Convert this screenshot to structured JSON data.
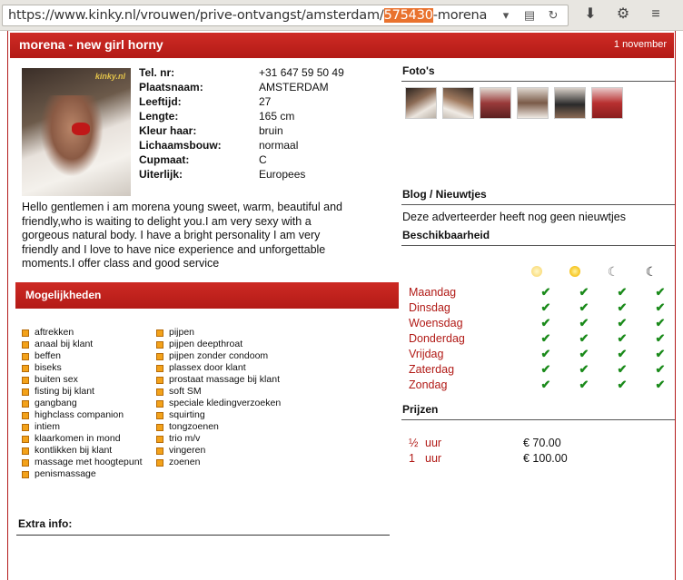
{
  "browser": {
    "url_prefix": "https://www.kinky.nl/vrouwen/prive-ontvangst/amsterdam/",
    "url_highlight": "575430",
    "url_suffix": "-morena"
  },
  "header": {
    "title": "morena - new girl horny",
    "date": "1 november"
  },
  "photo": {
    "watermark": "kinky.nl"
  },
  "details": [
    {
      "label": "Tel. nr:",
      "value": "+31 647 59 50 49"
    },
    {
      "label": "Plaatsnaam:",
      "value": "AMSTERDAM"
    },
    {
      "label": "Leeftijd:",
      "value": "27"
    },
    {
      "label": "Lengte:",
      "value": "165 cm"
    },
    {
      "label": "Kleur haar:",
      "value": "bruin"
    },
    {
      "label": "Lichaamsbouw:",
      "value": "normaal"
    },
    {
      "label": "Cupmaat:",
      "value": "C"
    },
    {
      "label": "Uiterlijk:",
      "value": "Europees"
    }
  ],
  "bio": "Hello gentlemen i am morena young sweet, warm, beautiful and friendly,who is waiting to delight you.I am very sexy with a gorgeous natural body. I have a bright personality I am very friendly and I love to have nice experience and unforgettable moments.I offer class and good service",
  "mogelijkheden": {
    "title": "Mogelijkheden",
    "col1": [
      "aftrekken",
      "anaal bij klant",
      "beffen",
      "biseks",
      "buiten sex",
      "fisting bij klant",
      "gangbang",
      "highclass companion",
      "intiem",
      "klaarkomen in mond",
      "kontlikken bij klant",
      "massage met hoogtepunt",
      "penismassage"
    ],
    "col2": [
      "pijpen",
      "pijpen deepthroat",
      "pijpen zonder condoom",
      "plassex door klant",
      "prostaat massage bij klant",
      "soft SM",
      "speciale kledingverzoeken",
      "squirting",
      "tongzoenen",
      "trio m/v",
      "vingeren",
      "zoenen"
    ]
  },
  "extra": {
    "title": "Extra info:"
  },
  "fotos": {
    "title": "Foto's"
  },
  "blog": {
    "title": "Blog / Nieuwtjes",
    "text": "Deze adverteerder heeft nog geen nieuwtjes"
  },
  "beschikbaarheid": {
    "title": "Beschikbaarheid",
    "days": [
      "Maandag",
      "Dinsdag",
      "Woensdag",
      "Donderdag",
      "Vrijdag",
      "Zaterdag",
      "Zondag"
    ]
  },
  "prijzen": {
    "title": "Prijzen",
    "rows": [
      {
        "qty": "½",
        "unit": "uur",
        "price": "€ 70.00"
      },
      {
        "qty": "1",
        "unit": "uur",
        "price": "€ 100.00"
      }
    ]
  },
  "colors": {
    "accent": "#b31a16",
    "check": "#1a8a1a",
    "bullet": "#f3a21a"
  }
}
